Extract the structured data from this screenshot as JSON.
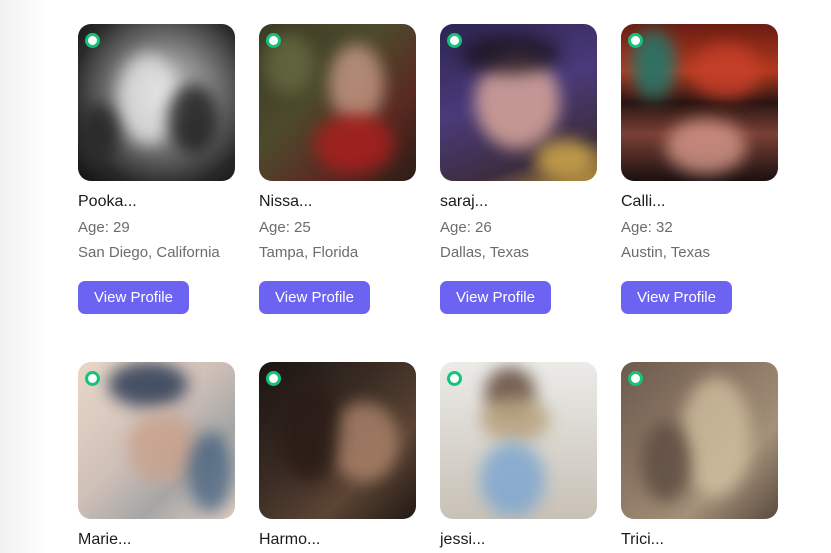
{
  "colors": {
    "accent": "#6c63f2",
    "online": "#17c27a",
    "name_text": "#1b1b1b",
    "meta_text": "#6c6c6c"
  },
  "profiles": [
    {
      "name": "Pooka...",
      "age": "Age: 29",
      "location": "San Diego, California",
      "button": "View Profile",
      "online": true
    },
    {
      "name": "Nissa...",
      "age": "Age: 25",
      "location": "Tampa, Florida",
      "button": "View Profile",
      "online": true
    },
    {
      "name": "saraj...",
      "age": "Age: 26",
      "location": "Dallas, Texas",
      "button": "View Profile",
      "online": true
    },
    {
      "name": "Calli...",
      "age": "Age: 32",
      "location": "Austin, Texas",
      "button": "View Profile",
      "online": true
    },
    {
      "name": "Marie...",
      "online": true
    },
    {
      "name": "Harmo...",
      "online": true
    },
    {
      "name": "jessi...",
      "online": true
    },
    {
      "name": "Trici...",
      "online": true
    }
  ]
}
